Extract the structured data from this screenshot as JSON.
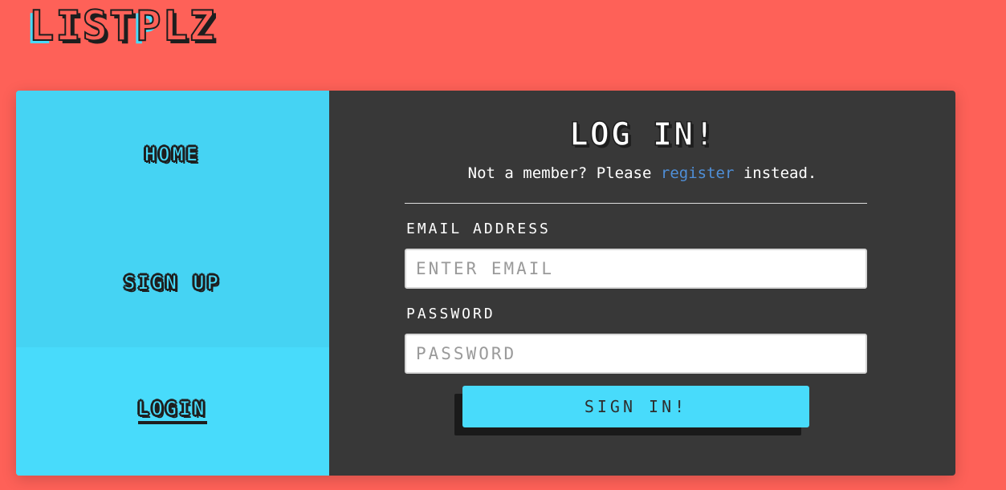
{
  "brand": {
    "letters": [
      "L",
      "I",
      "S",
      "T",
      "P",
      "L",
      "Z"
    ],
    "alt_indices": [
      0,
      4
    ]
  },
  "nav": {
    "home_label": "HOME",
    "signup_label": "SIGN UP",
    "login_label": "LOGIN",
    "active": "login"
  },
  "form": {
    "title": "LOG IN!",
    "subtitle_prefix": "Not a member? Please ",
    "subtitle_link": "register",
    "subtitle_suffix": " instead.",
    "email_label": "EMAIL ADDRESS",
    "email_placeholder": "ENTER EMAIL",
    "email_value": "",
    "password_label": "PASSWORD",
    "password_placeholder": "PASSWORD",
    "password_value": "",
    "submit_label": "SIGN IN!"
  },
  "colors": {
    "background": "#fe6158",
    "accent": "#48dbfb",
    "panel": "#383838",
    "link": "#4f8fd8"
  }
}
